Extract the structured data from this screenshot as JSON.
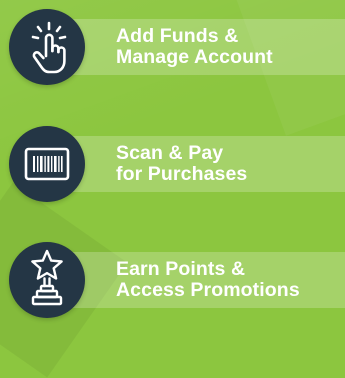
{
  "colors": {
    "background": "#8cc63f",
    "icon_circle": "#243645",
    "text": "#ffffff"
  },
  "features": [
    {
      "icon": "tap-hand-icon",
      "line1": "Add Funds &",
      "line2": "Manage Account"
    },
    {
      "icon": "barcode-icon",
      "line1": "Scan & Pay",
      "line2": "for Purchases"
    },
    {
      "icon": "star-trophy-icon",
      "line1": "Earn Points &",
      "line2": "Access Promotions"
    }
  ]
}
